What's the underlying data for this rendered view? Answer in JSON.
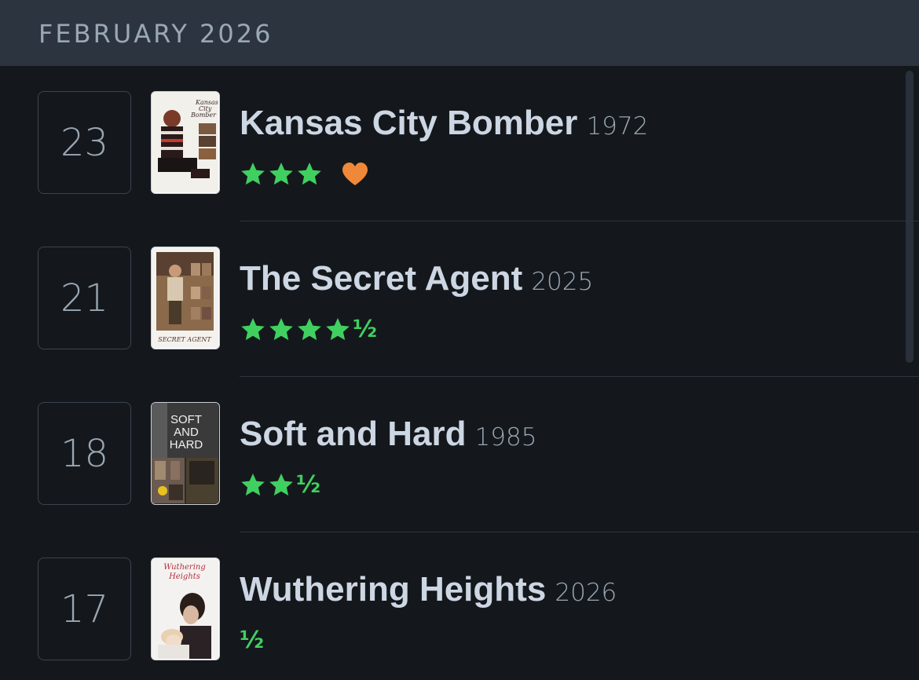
{
  "month_header": {
    "label": "FEBRUARY 2026"
  },
  "entries": [
    {
      "day": "23",
      "title": "Kansas City Bomber",
      "year": "1972",
      "stars": 3,
      "half_label": "",
      "liked": true,
      "poster_text": "Kansas City Bomber"
    },
    {
      "day": "21",
      "title": "The Secret Agent",
      "year": "2025",
      "stars": 4,
      "half_label": "½",
      "liked": false,
      "poster_text": "SECRET AGENT"
    },
    {
      "day": "18",
      "title": "Soft and Hard",
      "year": "1985",
      "stars": 2,
      "half_label": "½",
      "liked": false,
      "poster_text": "SOFT AND HARD"
    },
    {
      "day": "17",
      "title": "Wuthering Heights",
      "year": "2026",
      "stars": 0,
      "half_label": "½",
      "liked": false,
      "poster_text": "Wuthering Heights"
    }
  ],
  "colors": {
    "star": "#40d060",
    "heart": "#f0883a",
    "header_bg": "#2c3440",
    "page_bg": "#14181c"
  },
  "icons": {
    "star": "star-icon",
    "heart": "heart-icon"
  }
}
